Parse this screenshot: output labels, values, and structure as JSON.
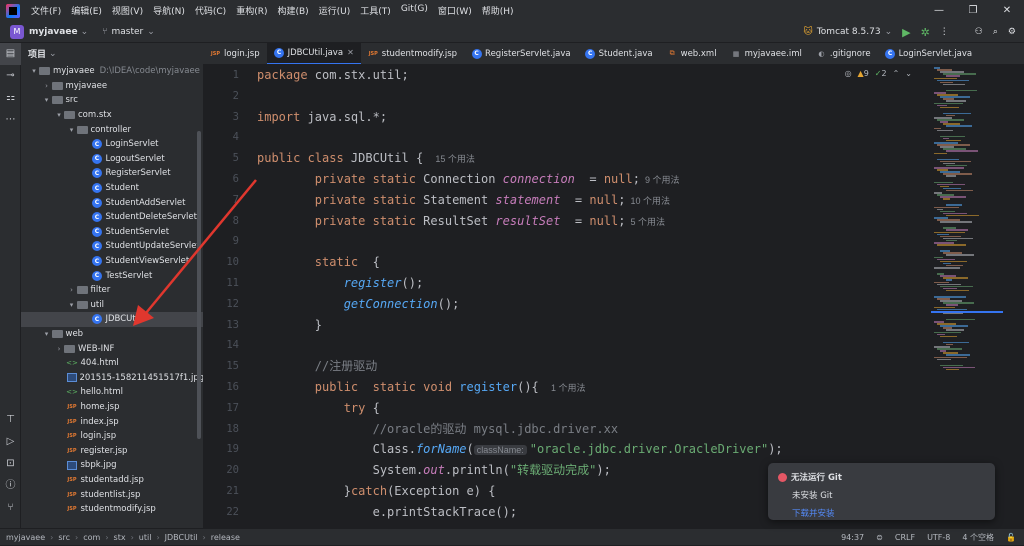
{
  "menu": [
    "文件(F)",
    "编辑(E)",
    "视图(V)",
    "导航(N)",
    "代码(C)",
    "重构(R)",
    "构建(B)",
    "运行(U)",
    "工具(T)",
    "Git(G)",
    "窗口(W)",
    "帮助(H)"
  ],
  "toolbar": {
    "project_initial": "M",
    "project": "myjavaee",
    "branch": "master",
    "run_config": "Tomcat 8.5.73"
  },
  "panel": {
    "title": "项目"
  },
  "tree": [
    {
      "label": "myjavaee",
      "hint": "D:\\IDEA\\code\\myjavaee",
      "depth": 0,
      "arrow": "▾",
      "icon": "folder"
    },
    {
      "label": "myjavaee",
      "depth": 1,
      "arrow": "›",
      "icon": "folder"
    },
    {
      "label": "src",
      "depth": 1,
      "arrow": "▾",
      "icon": "folder"
    },
    {
      "label": "com.stx",
      "depth": 2,
      "arrow": "▾",
      "icon": "folder"
    },
    {
      "label": "controller",
      "depth": 3,
      "arrow": "▾",
      "icon": "folder"
    },
    {
      "label": "LoginServlet",
      "depth": 5,
      "icon": "class"
    },
    {
      "label": "LogoutServlet",
      "depth": 5,
      "icon": "class"
    },
    {
      "label": "RegisterServlet",
      "depth": 5,
      "icon": "class"
    },
    {
      "label": "Student",
      "depth": 5,
      "icon": "class"
    },
    {
      "label": "StudentAddServlet",
      "depth": 5,
      "icon": "class"
    },
    {
      "label": "StudentDeleteServlet",
      "depth": 5,
      "icon": "class"
    },
    {
      "label": "StudentServlet",
      "depth": 5,
      "icon": "class"
    },
    {
      "label": "StudentUpdateServlet",
      "depth": 5,
      "icon": "class"
    },
    {
      "label": "StudentViewServlet",
      "depth": 5,
      "icon": "class"
    },
    {
      "label": "TestServlet",
      "depth": 5,
      "icon": "class"
    },
    {
      "label": "filter",
      "depth": 3,
      "arrow": "›",
      "icon": "folder"
    },
    {
      "label": "util",
      "depth": 3,
      "arrow": "▾",
      "icon": "folder"
    },
    {
      "label": "JDBCUtil",
      "depth": 5,
      "icon": "class",
      "selected": true
    },
    {
      "label": "web",
      "depth": 1,
      "arrow": "▾",
      "icon": "folder"
    },
    {
      "label": "WEB-INF",
      "depth": 2,
      "arrow": "›",
      "icon": "folder"
    },
    {
      "label": "404.html",
      "depth": 3,
      "icon": "html"
    },
    {
      "label": "201515-158211451517f1.jpg",
      "depth": 3,
      "icon": "image"
    },
    {
      "label": "hello.html",
      "depth": 3,
      "icon": "html"
    },
    {
      "label": "home.jsp",
      "depth": 3,
      "icon": "jsp"
    },
    {
      "label": "index.jsp",
      "depth": 3,
      "icon": "jsp"
    },
    {
      "label": "login.jsp",
      "depth": 3,
      "icon": "jsp"
    },
    {
      "label": "register.jsp",
      "depth": 3,
      "icon": "jsp"
    },
    {
      "label": "sbpk.jpg",
      "depth": 3,
      "icon": "image"
    },
    {
      "label": "studentadd.jsp",
      "depth": 3,
      "icon": "jsp"
    },
    {
      "label": "studentlist.jsp",
      "depth": 3,
      "icon": "jsp"
    },
    {
      "label": "studentmodify.jsp",
      "depth": 3,
      "icon": "jsp"
    }
  ],
  "tabs": [
    {
      "label": "login.jsp",
      "icon": "jsp"
    },
    {
      "label": "JDBCUtil.java",
      "icon": "class",
      "active": true
    },
    {
      "label": "studentmodify.jsp",
      "icon": "jsp"
    },
    {
      "label": "RegisterServlet.java",
      "icon": "class"
    },
    {
      "label": "Student.java",
      "icon": "class"
    },
    {
      "label": "web.xml",
      "icon": "xml"
    },
    {
      "label": "myjavaee.iml",
      "icon": "iml"
    },
    {
      "label": ".gitignore",
      "icon": "git"
    },
    {
      "label": "LoginServlet.java",
      "icon": "class"
    }
  ],
  "inspections": {
    "warnings": "9",
    "weak": "2"
  },
  "code": [
    [
      [
        "kw",
        "package "
      ],
      [
        "",
        "com.stx.util;"
      ]
    ],
    [],
    [
      [
        "kw",
        "import "
      ],
      [
        "",
        "java.sql.*;"
      ]
    ],
    [],
    [
      [
        "kw",
        "public class "
      ],
      [
        "",
        "JDBCUtil { "
      ],
      [
        "hint",
        "15 个用法"
      ]
    ],
    [
      [
        "",
        "        "
      ],
      [
        "kw",
        "private static "
      ],
      [
        "",
        "Connection "
      ],
      [
        "fld",
        "connection"
      ],
      [
        "",
        ""
      ],
      [
        "",
        "  = "
      ],
      [
        "kw",
        "null"
      ],
      [
        "",
        ";"
      ],
      [
        "hint",
        "9 个用法"
      ]
    ],
    [
      [
        "",
        "        "
      ],
      [
        "kw",
        "private static "
      ],
      [
        "",
        "Statement "
      ],
      [
        "fld",
        "statement"
      ],
      [
        "",
        "  = "
      ],
      [
        "kw",
        "null"
      ],
      [
        "",
        ";"
      ],
      [
        "hint",
        "10 个用法"
      ]
    ],
    [
      [
        "",
        "        "
      ],
      [
        "kw",
        "private static "
      ],
      [
        "",
        "ResultSet "
      ],
      [
        "fld",
        "resultSet"
      ],
      [
        "",
        "  = "
      ],
      [
        "kw",
        "null"
      ],
      [
        "",
        ";"
      ],
      [
        "hint",
        "5 个用法"
      ]
    ],
    [],
    [
      [
        "",
        "        "
      ],
      [
        "kw",
        "static  "
      ],
      [
        "",
        "{"
      ]
    ],
    [
      [
        "",
        "            "
      ],
      [
        "fnit",
        "register"
      ],
      [
        "",
        "();"
      ]
    ],
    [
      [
        "",
        "            "
      ],
      [
        "fnit",
        "getConnection"
      ],
      [
        "",
        "();"
      ]
    ],
    [
      [
        "",
        "        }"
      ]
    ],
    [],
    [
      [
        "",
        "        "
      ],
      [
        "cm",
        "//注册驱动"
      ]
    ],
    [
      [
        "",
        "        "
      ],
      [
        "kw",
        "public  static void "
      ],
      [
        "fn",
        "register"
      ],
      [
        "",
        "(){ "
      ],
      [
        "hint",
        "1 个用法"
      ]
    ],
    [
      [
        "",
        "            "
      ],
      [
        "kw",
        "try "
      ],
      [
        "",
        "{"
      ]
    ],
    [
      [
        "",
        "                "
      ],
      [
        "cm",
        "//oracle的驱动 mysql.jdbc.driver.xx"
      ]
    ],
    [
      [
        "",
        "                "
      ],
      [
        "",
        "Class."
      ],
      [
        "fnit",
        "forName"
      ],
      [
        "",
        "("
      ],
      [
        "param",
        "className:"
      ],
      [
        "str",
        "\"oracle.jdbc.driver.OracleDriver\""
      ],
      [
        "",
        ");"
      ]
    ],
    [
      [
        "",
        "                "
      ],
      [
        "",
        "System."
      ],
      [
        "fld",
        "out"
      ],
      [
        "",
        ".println("
      ],
      [
        "str",
        "\"转载驱动完成\""
      ],
      [
        "",
        ");"
      ]
    ],
    [
      [
        "",
        "            "
      ],
      [
        "kw2",
        "}catch"
      ],
      [
        "",
        "(Exception e) {"
      ]
    ],
    [
      [
        "",
        "                "
      ],
      [
        "",
        "e.printStackTrace();"
      ]
    ]
  ],
  "statusbar": {
    "crumbs": [
      "myjavaee",
      "src",
      "com",
      "stx",
      "util",
      "JDBCUtil",
      "release"
    ],
    "position": "94:37",
    "line_sep": "CRLF",
    "encoding": "UTF-8",
    "indent": "4 个空格"
  },
  "toast": {
    "title": "无法运行 Git",
    "body": "未安装 Git",
    "link": "下载并安装"
  },
  "colors": {
    "accent": "#3574f0",
    "arrow": "#e0372e",
    "keyword": "#cf8e6d",
    "string": "#6aab73"
  }
}
